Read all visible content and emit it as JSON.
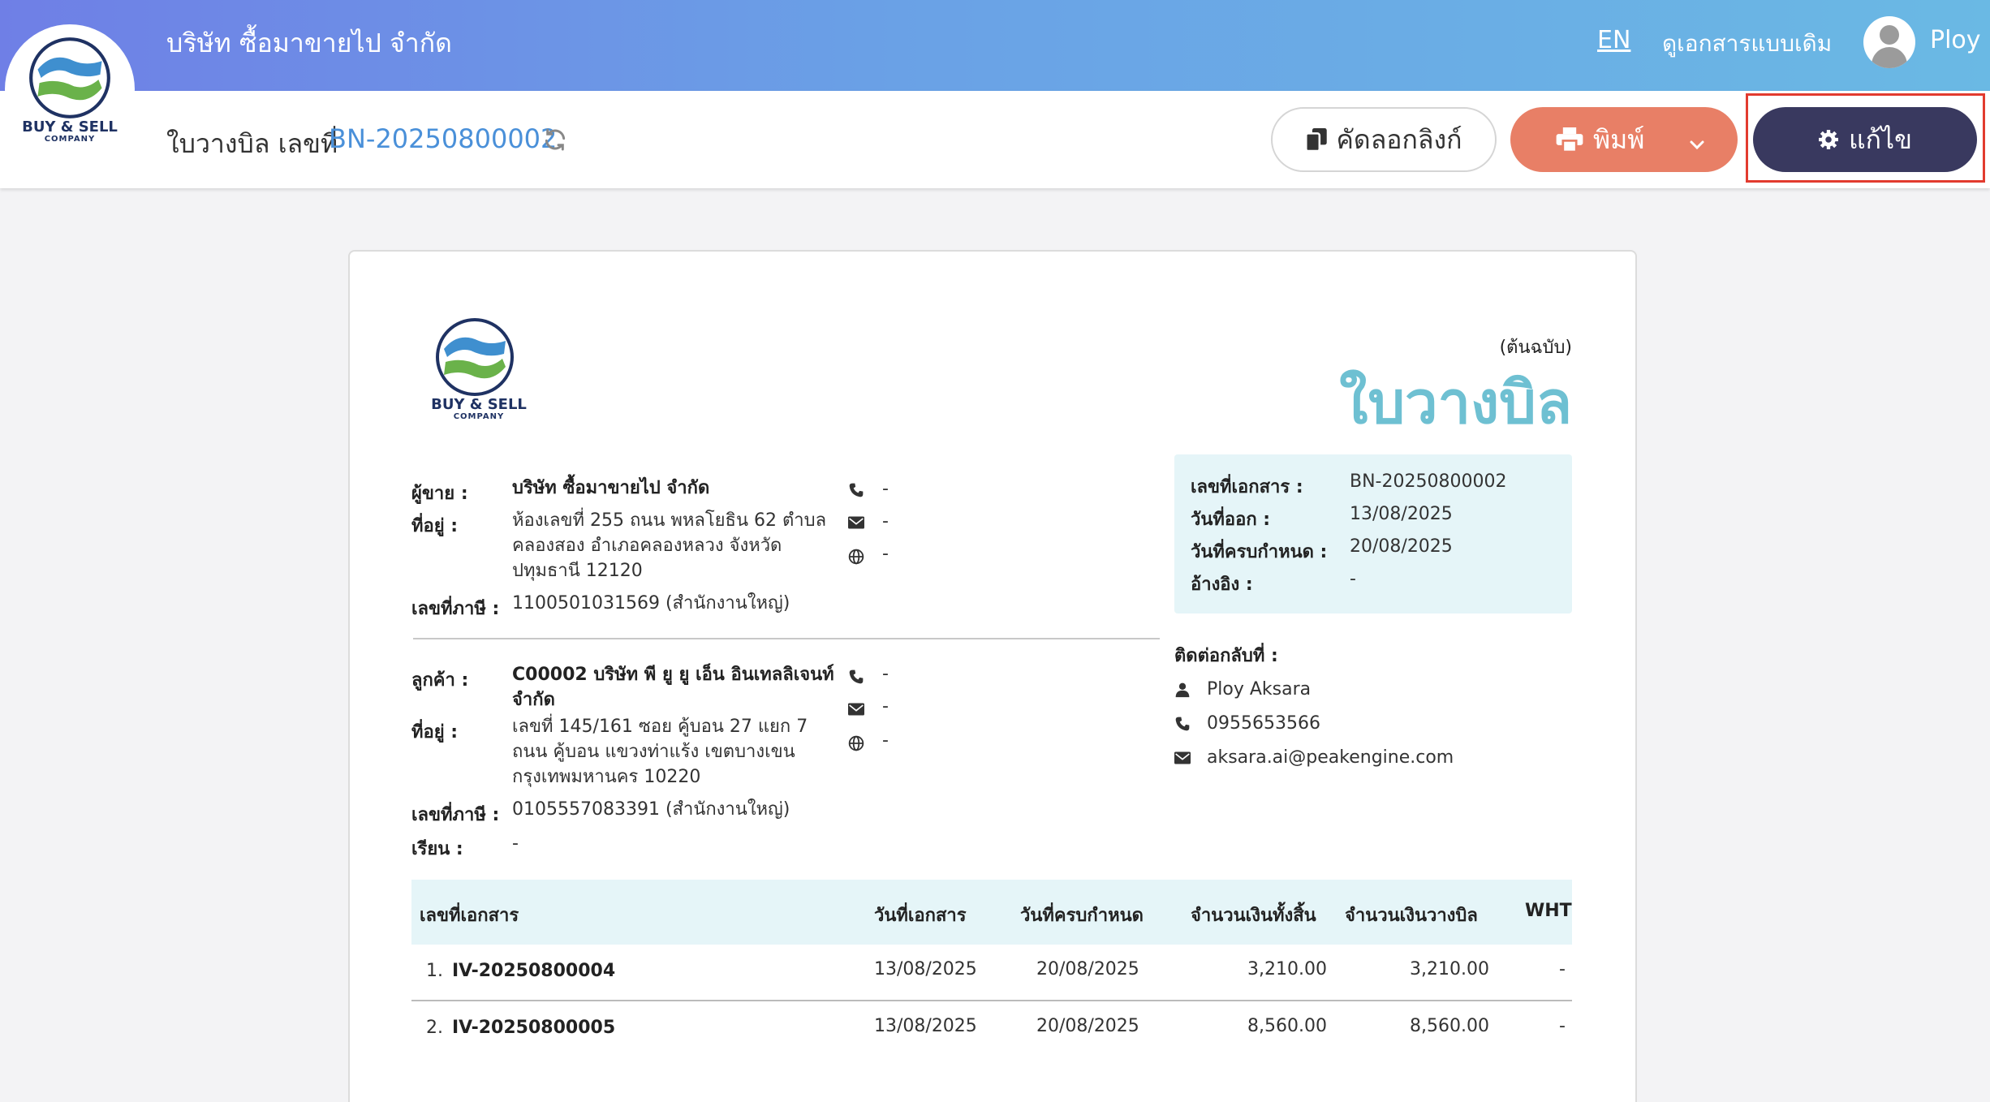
{
  "header": {
    "company_name": "บริษัท ซื้อมาขายไป จำกัด",
    "lang": "EN",
    "legacy_view": "ดูเอกสารแบบเดิม",
    "user_name": "Ploy",
    "logo_text": "BUY & SELL",
    "logo_subtext": "COMPANY"
  },
  "subbar": {
    "doc_prefix": "ใบวางบิล เลขที่",
    "doc_number": "BN-20250800002",
    "copy_link_label": "คัดลอกลิงก์",
    "print_label": "พิมพ์",
    "edit_label": "แก้ไข"
  },
  "document": {
    "original_label": "(ต้นฉบับ)",
    "title": "ใบวางบิล",
    "seller": {
      "label": "ผู้ขาย :",
      "name": "บริษัท ซื้อมาขายไป จำกัด",
      "address_label": "ที่อยู่ :",
      "address_line1": "ห้องเลขที่ 255 ถนน พหลโยธิน 62 ตำบล",
      "address_line2": "คลองสอง อำเภอคลองหลวง จังหวัด",
      "address_line3": "ปทุมธานี 12120",
      "tax_label": "เลขที่ภาษี :",
      "tax_id": "1100501031569 (สำนักงานใหญ่)",
      "phone": "-",
      "email": "-",
      "web": "-"
    },
    "customer": {
      "label": "ลูกค้า :",
      "name_line1": "C00002 บริษัท พี ยู ยู เอ็น อินเทลลิเจนท์",
      "name_line2": "จำกัด",
      "address_label": "ที่อยู่ :",
      "address_line1": "เลขที่ 145/161     ซอย คู้บอน 27 แยก 7",
      "address_line2": "ถนน คู้บอน  แขวงท่าแร้ง เขตบางเขน",
      "address_line3": "กรุงเทพมหานคร 10220",
      "tax_label": "เลขที่ภาษี :",
      "tax_id": "0105557083391 (สำนักงานใหญ่)",
      "attn_label": "เรียน :",
      "attn": "-",
      "phone": "-",
      "email": "-",
      "web": "-"
    },
    "info": {
      "doc_no_label": "เลขที่เอกสาร :",
      "doc_no": "BN-20250800002",
      "issue_label": "วันที่ออก :",
      "issue_date": "13/08/2025",
      "due_label": "วันที่ครบกำหนด :",
      "due_date": "20/08/2025",
      "ref_label": "อ้างอิง :",
      "ref": "-"
    },
    "contact": {
      "label": "ติดต่อกลับที่ :",
      "name": "Ploy Aksara",
      "phone": "0955653566",
      "email": "aksara.ai@peakengine.com"
    },
    "table": {
      "headers": [
        "เลขที่เอกสาร",
        "วันที่เอกสาร",
        "วันที่ครบกำหนด",
        "จำนวนเงินทั้งสิ้น",
        "จำนวนเงินวางบิล",
        "WHT"
      ],
      "rows": [
        {
          "index": "1.",
          "doc": "IV-20250800004",
          "date": "13/08/2025",
          "due": "20/08/2025",
          "total": "3,210.00",
          "billed": "3,210.00",
          "wht": "-"
        },
        {
          "index": "2.",
          "doc": "IV-20250800005",
          "date": "13/08/2025",
          "due": "20/08/2025",
          "total": "8,560.00",
          "billed": "8,560.00",
          "wht": "-"
        }
      ]
    }
  }
}
